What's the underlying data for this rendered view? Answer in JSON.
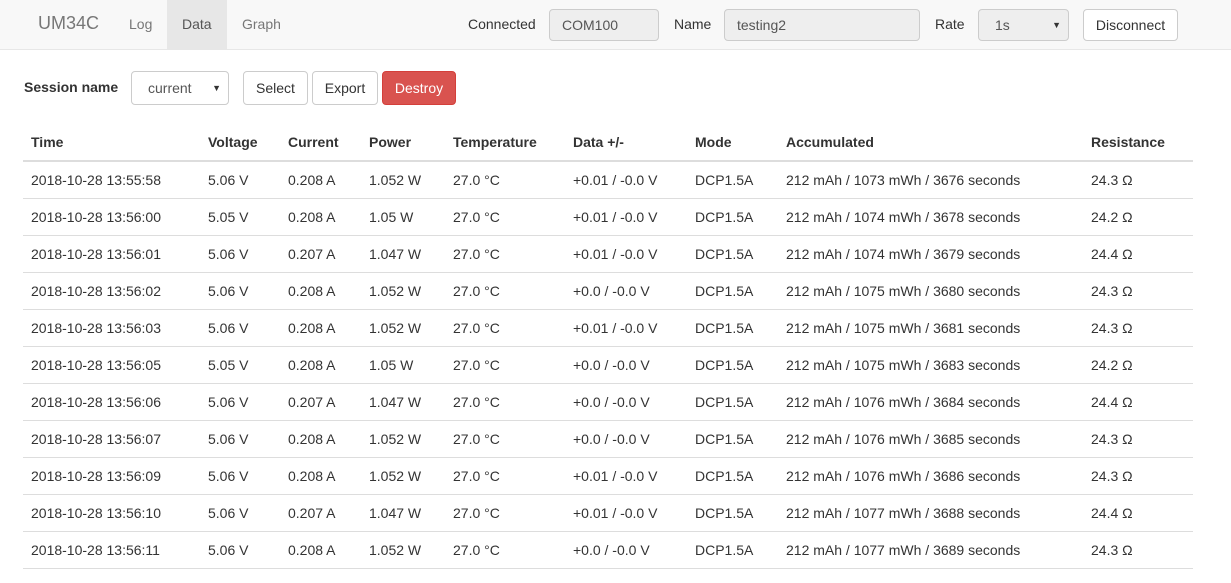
{
  "navbar": {
    "brand": "UM34C",
    "tabs": [
      {
        "label": "Log",
        "active": false
      },
      {
        "label": "Data",
        "active": true
      },
      {
        "label": "Graph",
        "active": false
      }
    ],
    "connected_label": "Connected",
    "connected_value": "COM100",
    "name_label": "Name",
    "name_value": "testing2",
    "rate_label": "Rate",
    "rate_value": "1s",
    "disconnect_label": "Disconnect"
  },
  "session": {
    "label": "Session name",
    "selected": "current",
    "select_label": "Select",
    "export_label": "Export",
    "destroy_label": "Destroy"
  },
  "colors": {
    "danger": "#d9534f",
    "navbar_bg": "#f8f8f8",
    "active_tab_bg": "#e7e7e7"
  },
  "table": {
    "columns": [
      "Time",
      "Voltage",
      "Current",
      "Power",
      "Temperature",
      "Data +/-",
      "Mode",
      "Accumulated",
      "Resistance"
    ],
    "rows": [
      [
        "2018-10-28 13:55:58",
        "5.06 V",
        "0.208 A",
        "1.052 W",
        "27.0 °C",
        "+0.01 / -0.0 V",
        "DCP1.5A",
        "212 mAh / 1073 mWh / 3676 seconds",
        "24.3 Ω"
      ],
      [
        "2018-10-28 13:56:00",
        "5.05 V",
        "0.208 A",
        "1.05 W",
        "27.0 °C",
        "+0.01 / -0.0 V",
        "DCP1.5A",
        "212 mAh / 1074 mWh / 3678 seconds",
        "24.2 Ω"
      ],
      [
        "2018-10-28 13:56:01",
        "5.06 V",
        "0.207 A",
        "1.047 W",
        "27.0 °C",
        "+0.01 / -0.0 V",
        "DCP1.5A",
        "212 mAh / 1074 mWh / 3679 seconds",
        "24.4 Ω"
      ],
      [
        "2018-10-28 13:56:02",
        "5.06 V",
        "0.208 A",
        "1.052 W",
        "27.0 °C",
        "+0.0 / -0.0 V",
        "DCP1.5A",
        "212 mAh / 1075 mWh / 3680 seconds",
        "24.3 Ω"
      ],
      [
        "2018-10-28 13:56:03",
        "5.06 V",
        "0.208 A",
        "1.052 W",
        "27.0 °C",
        "+0.01 / -0.0 V",
        "DCP1.5A",
        "212 mAh / 1075 mWh / 3681 seconds",
        "24.3 Ω"
      ],
      [
        "2018-10-28 13:56:05",
        "5.05 V",
        "0.208 A",
        "1.05 W",
        "27.0 °C",
        "+0.0 / -0.0 V",
        "DCP1.5A",
        "212 mAh / 1075 mWh / 3683 seconds",
        "24.2 Ω"
      ],
      [
        "2018-10-28 13:56:06",
        "5.06 V",
        "0.207 A",
        "1.047 W",
        "27.0 °C",
        "+0.0 / -0.0 V",
        "DCP1.5A",
        "212 mAh / 1076 mWh / 3684 seconds",
        "24.4 Ω"
      ],
      [
        "2018-10-28 13:56:07",
        "5.06 V",
        "0.208 A",
        "1.052 W",
        "27.0 °C",
        "+0.0 / -0.0 V",
        "DCP1.5A",
        "212 mAh / 1076 mWh / 3685 seconds",
        "24.3 Ω"
      ],
      [
        "2018-10-28 13:56:09",
        "5.06 V",
        "0.208 A",
        "1.052 W",
        "27.0 °C",
        "+0.01 / -0.0 V",
        "DCP1.5A",
        "212 mAh / 1076 mWh / 3686 seconds",
        "24.3 Ω"
      ],
      [
        "2018-10-28 13:56:10",
        "5.06 V",
        "0.207 A",
        "1.047 W",
        "27.0 °C",
        "+0.01 / -0.0 V",
        "DCP1.5A",
        "212 mAh / 1077 mWh / 3688 seconds",
        "24.4 Ω"
      ],
      [
        "2018-10-28 13:56:11",
        "5.06 V",
        "0.208 A",
        "1.052 W",
        "27.0 °C",
        "+0.0 / -0.0 V",
        "DCP1.5A",
        "212 mAh / 1077 mWh / 3689 seconds",
        "24.3 Ω"
      ]
    ]
  }
}
